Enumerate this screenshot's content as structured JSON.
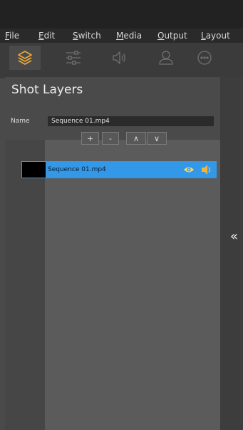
{
  "menu": [
    {
      "mn": "F",
      "rest": "ile"
    },
    {
      "mn": "E",
      "rest": "dit"
    },
    {
      "mn": "S",
      "rest": "witch"
    },
    {
      "mn": "M",
      "rest": "edia"
    },
    {
      "mn": "O",
      "rest": "utput"
    },
    {
      "mn": "L",
      "rest": "ayout"
    }
  ],
  "toolbar": {
    "tools": [
      {
        "icon": "layers-icon",
        "active": true
      },
      {
        "icon": "sliders-icon",
        "active": false
      },
      {
        "icon": "speaker-icon",
        "active": false
      },
      {
        "icon": "user-icon",
        "active": false
      },
      {
        "icon": "more-icon",
        "active": false
      }
    ],
    "accent_color": "#e8a838"
  },
  "panel": {
    "title": "Shot Layers",
    "name_label": "Name",
    "name_value": "Sequence 01.mp4"
  },
  "controls": {
    "add": "+",
    "remove": "-",
    "up": "∧",
    "down": "∨"
  },
  "layers": [
    {
      "name": "Sequence 01.mp4",
      "visible": true,
      "audio": true,
      "selected": true
    }
  ],
  "colors": {
    "selection": "#3398e8",
    "eye": "#f5d66b",
    "speaker": "#f2b33a"
  },
  "collapse": "«"
}
